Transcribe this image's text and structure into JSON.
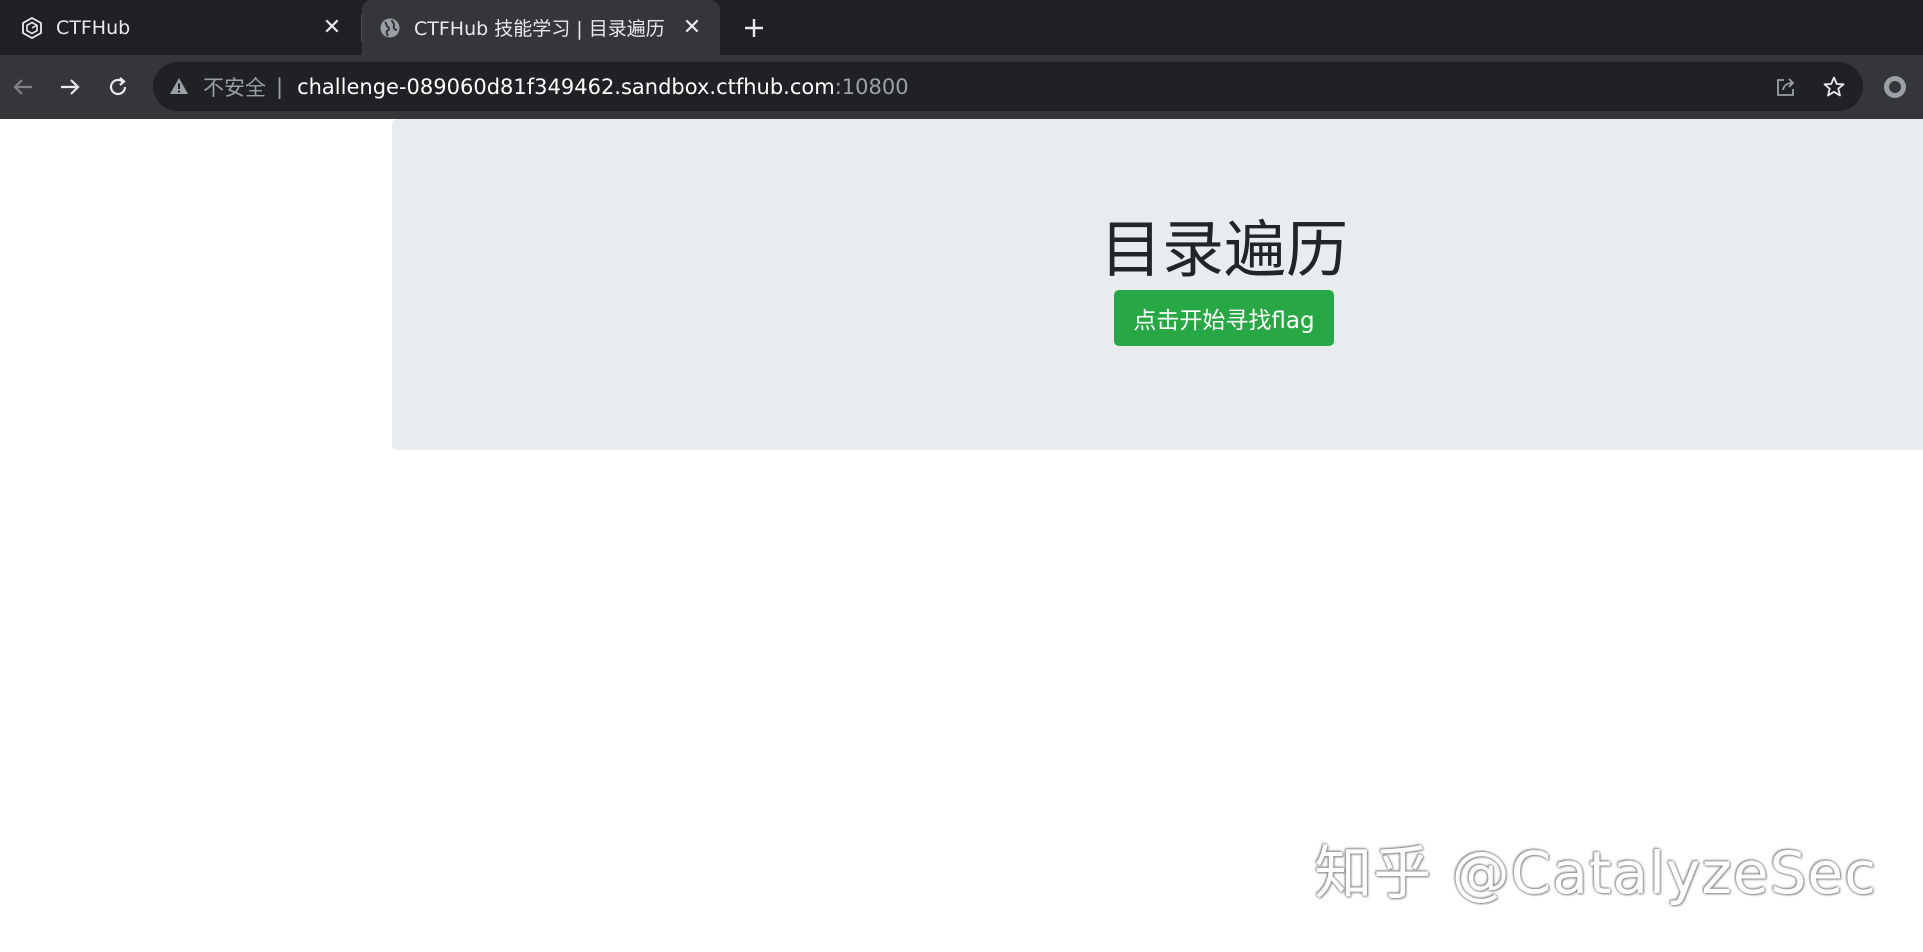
{
  "tabs": [
    {
      "title": "CTFHub",
      "icon": "ctfhub-logo-icon",
      "active": false
    },
    {
      "title": "CTFHub 技能学习 | 目录遍历",
      "icon": "globe-icon",
      "active": true
    }
  ],
  "address_bar": {
    "security_label": "不安全",
    "separator": "|",
    "host": "challenge-089060d81f349462.sandbox.ctfhub.com",
    "port": ":10800"
  },
  "page": {
    "title": "目录遍历",
    "button_label": "点击开始寻找flag"
  },
  "watermark": "知乎 @CatalyzeSec",
  "colors": {
    "tabstrip_bg": "#1f2023",
    "toolbar_bg": "#35363a",
    "omnibox_bg": "#202124",
    "jumbotron_bg": "#e9ecef",
    "button_bg": "#28a745"
  }
}
